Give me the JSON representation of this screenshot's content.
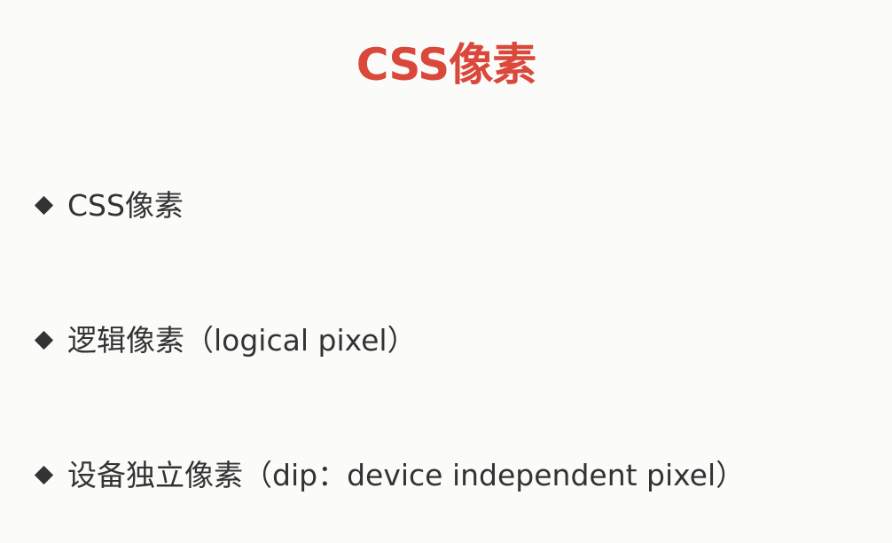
{
  "slide": {
    "title": "CSS像素",
    "bullets": [
      {
        "text": "CSS像素"
      },
      {
        "text": "逻辑像素（logical pixel）"
      },
      {
        "text": "设备独立像素（dip：device independent pixel）"
      }
    ]
  },
  "colors": {
    "title": "#d9483b",
    "text": "#333333",
    "background": "#fbfbf9",
    "bullet_marker": "#333333"
  },
  "icons": {
    "bullet_marker": "diamond-bullet-icon"
  }
}
